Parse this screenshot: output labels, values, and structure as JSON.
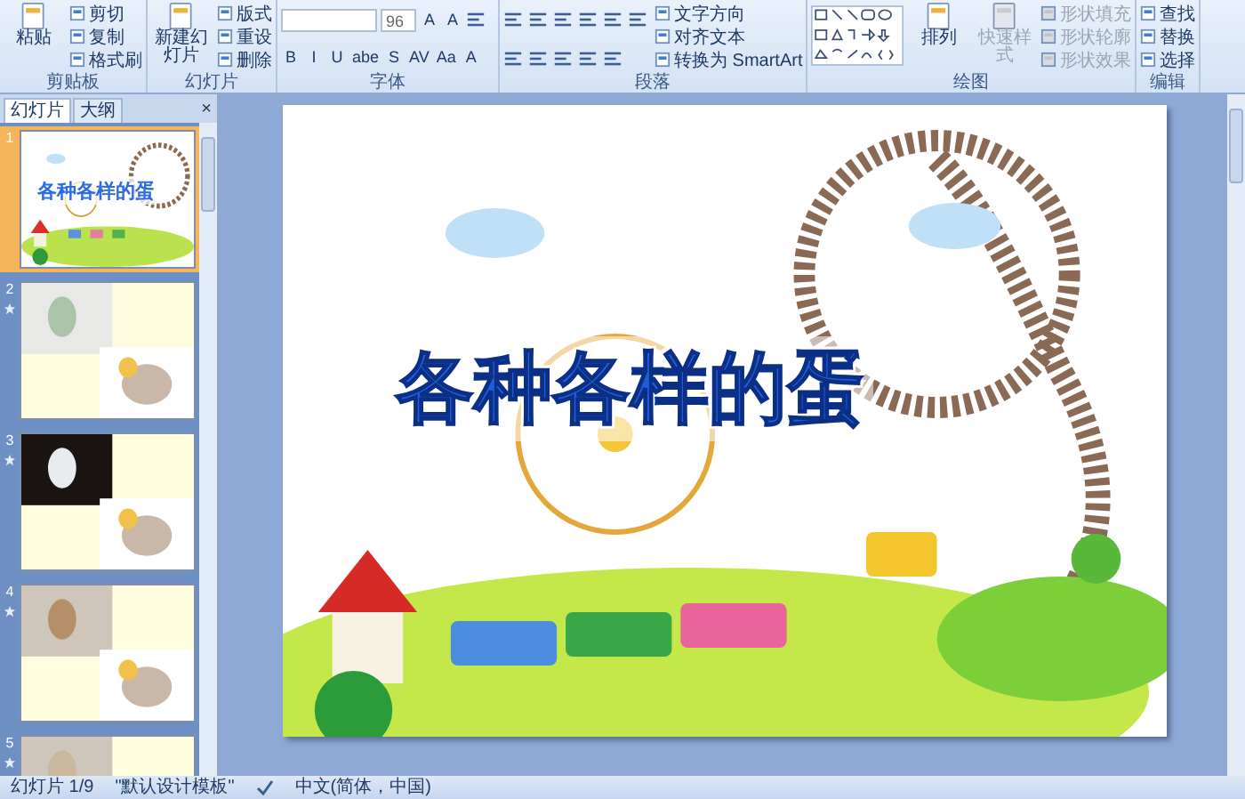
{
  "ribbon": {
    "groups": [
      {
        "label": "剪贴板",
        "items": [
          {
            "kind": "large",
            "label": "粘贴"
          },
          {
            "kind": "small",
            "label": "剪切"
          },
          {
            "kind": "small",
            "label": "复制"
          },
          {
            "kind": "small",
            "label": "格式刷"
          }
        ]
      },
      {
        "label": "幻灯片",
        "items": [
          {
            "kind": "large",
            "label": "新建幻灯片"
          },
          {
            "kind": "small",
            "label": "版式"
          },
          {
            "kind": "small",
            "label": "重设"
          },
          {
            "kind": "small",
            "label": "删除"
          }
        ]
      },
      {
        "label": "字体",
        "controls": [
          {
            "kind": "field"
          },
          {
            "kind": "field",
            "value": "96"
          },
          {
            "kind": "glyph",
            "label": "A"
          },
          {
            "kind": "glyph",
            "label": "A"
          },
          {
            "kind": "icon"
          },
          {
            "kind": "glyph",
            "label": "B"
          },
          {
            "kind": "glyph",
            "label": "I"
          },
          {
            "kind": "glyph",
            "label": "U"
          },
          {
            "kind": "glyph",
            "label": "abe"
          },
          {
            "kind": "glyph",
            "label": "S"
          },
          {
            "kind": "glyph",
            "label": "AV"
          },
          {
            "kind": "glyph",
            "label": "Aa"
          },
          {
            "kind": "glyph",
            "label": "A"
          }
        ]
      },
      {
        "label": "段落",
        "controls": [
          {
            "kind": "icon"
          },
          {
            "kind": "icon"
          },
          {
            "kind": "icon"
          },
          {
            "kind": "icon"
          },
          {
            "kind": "icon"
          },
          {
            "kind": "icon"
          },
          {
            "kind": "icon"
          },
          {
            "kind": "icon"
          },
          {
            "kind": "icon"
          },
          {
            "kind": "icon"
          },
          {
            "kind": "icon"
          }
        ],
        "items": [
          {
            "kind": "small",
            "label": "文字方向"
          },
          {
            "kind": "small",
            "label": "对齐文本"
          },
          {
            "kind": "small",
            "label": "转换为 SmartArt"
          }
        ]
      },
      {
        "label": "绘图",
        "items": [
          {
            "kind": "shapes",
            "disabled": false
          },
          {
            "kind": "large",
            "label": "排列",
            "disabled": false
          },
          {
            "kind": "large",
            "label": "快速样式",
            "disabled": true
          },
          {
            "kind": "small",
            "label": "形状填充",
            "disabled": true
          },
          {
            "kind": "small",
            "label": "形状轮廓",
            "disabled": true
          },
          {
            "kind": "small",
            "label": "形状效果",
            "disabled": true
          }
        ]
      },
      {
        "label": "编辑",
        "items": [
          {
            "kind": "small",
            "label": "查找"
          },
          {
            "kind": "small",
            "label": "替换"
          },
          {
            "kind": "small",
            "label": "选择"
          }
        ]
      }
    ]
  },
  "panel": {
    "tabs": [
      {
        "label": "幻灯片",
        "selected": true
      },
      {
        "label": "大纲",
        "selected": false
      }
    ],
    "close": "×",
    "slides": [
      {
        "number": "1",
        "selected": true,
        "animated": false,
        "title": "各种各样的蛋"
      },
      {
        "number": "2",
        "selected": false,
        "animated": true
      },
      {
        "number": "3",
        "selected": false,
        "animated": true
      },
      {
        "number": "4",
        "selected": false,
        "animated": true
      },
      {
        "number": "5",
        "selected": false,
        "animated": true
      }
    ]
  },
  "slide": {
    "title": "各种各样的蛋"
  },
  "status_bar": {
    "position": "幻灯片 1/9",
    "theme": "\"默认设计模板\"",
    "language": "中文(简体，中国)"
  }
}
